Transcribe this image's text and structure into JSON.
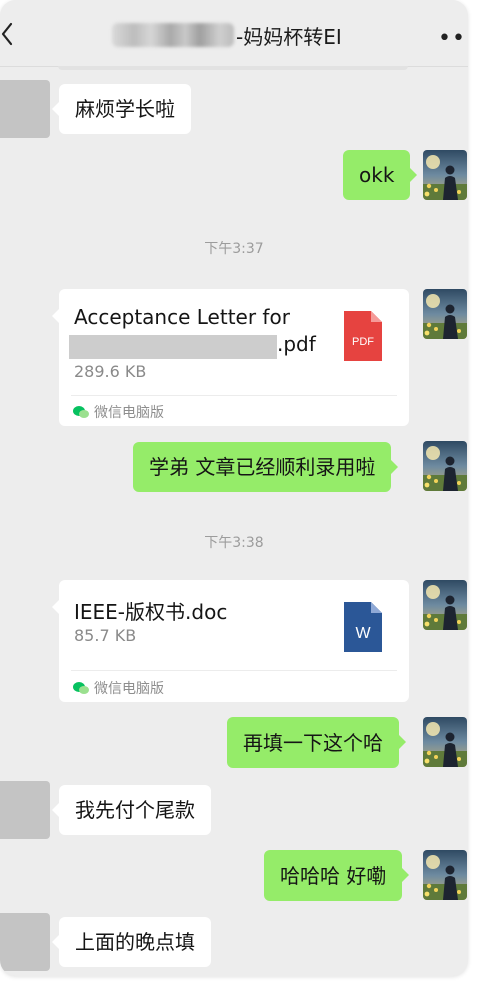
{
  "header": {
    "title_suffix": "-妈妈杯转EI",
    "more_icon": "more-dots-icon",
    "back_icon": "chevron-left-icon"
  },
  "messages": {
    "m1": "麻烦学长啦",
    "m2": "okk",
    "ts1": "下午3:37",
    "file1": {
      "name_line1": "Acceptance Letter for",
      "name_line2_suffix": ".pdf",
      "size": "289.6 KB",
      "source": "微信电脑版",
      "icon_label": "PDF"
    },
    "m3": "学弟 文章已经顺利录用啦",
    "ts2": "下午3:38",
    "file2": {
      "name": "IEEE-版权书.doc",
      "size": "85.7 KB",
      "source": "微信电脑版",
      "icon_label": "W"
    },
    "m4": "再填一下这个哈",
    "m5": "我先付个尾款",
    "m6": "哈哈哈 好嘞",
    "m7": "上面的晚点填"
  },
  "colors": {
    "outgoing_bubble": "#95ec69",
    "incoming_bubble": "#ffffff",
    "chat_background": "#ededed",
    "pdf_icon": "#e64340",
    "word_icon": "#2b5797",
    "wechat_green": "#07c160"
  }
}
